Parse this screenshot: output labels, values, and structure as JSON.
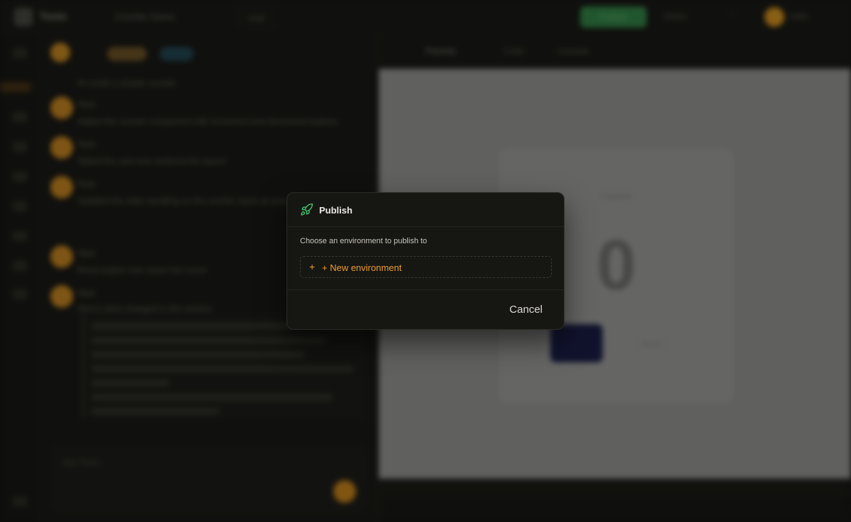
{
  "app": {
    "name": "Tonic",
    "project": "Counter Demo",
    "branch": "main",
    "publish_label": "Publish",
    "share_label": "Share",
    "user_name": "User"
  },
  "chat": {
    "composer_placeholder": "Ask Tonic...",
    "messages": [
      {
        "author": "Tonic",
        "text": "I'll create a simple counter."
      },
      {
        "author": "Tonic",
        "text": "Added the counter component with increment and decrement buttons."
      },
      {
        "author": "Tonic",
        "text": "Styled the card and centered the layout."
      },
      {
        "author": "Tonic",
        "text": "Updated the state handling so the counter starts at zero."
      },
      {
        "author": "Tonic",
        "text": "Reset button now clears the count."
      },
      {
        "author": "Tonic",
        "text": "Here's what changed in this version:"
      }
    ]
  },
  "preview": {
    "tabs": [
      "Preview",
      "Code",
      "Console"
    ],
    "card_title": "Counter",
    "count": "0",
    "primary_button": "+",
    "secondary_button": "Reset"
  },
  "modal": {
    "title": "Publish",
    "description": "Choose an environment to publish to",
    "new_environment_label": "+ New environment",
    "cancel_label": "Cancel",
    "accent_color": "#ee9f2f",
    "icon": "rocket-icon"
  }
}
